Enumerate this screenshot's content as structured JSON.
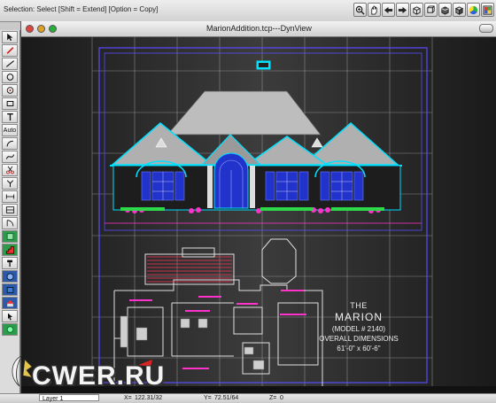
{
  "status_bar": {
    "text": "Selection: Select  [Shift = Extend]  [Option = Copy]"
  },
  "toolbar_icons": [
    "zoom-in-icon",
    "hand-pan-icon",
    "undo-arrow-icon",
    "redo-arrow-icon",
    "box-3d-icon",
    "box-3d-wire-icon",
    "box-3d-solid-icon",
    "color-wheel-icon",
    "palette-icon"
  ],
  "window": {
    "title": "MarionAddition.tcp---DynView"
  },
  "palette": {
    "auto_label": "Auto",
    "icons": [
      "arrow-select-icon",
      "pencil-icon",
      "line-icon",
      "circle-icon",
      "circle-dot-icon",
      "rectangle-icon",
      "text-icon",
      "auto-icon",
      "arc-icon",
      "curve-icon",
      "scissors-icon",
      "join-icon",
      "dimension-icon",
      "wall-icon",
      "door-icon",
      "window-icon",
      "stairs-icon",
      "hammer-icon",
      "cube-icon",
      "cube-blue-icon",
      "roof-icon",
      "pointer-icon",
      "green-shape-icon"
    ]
  },
  "drawing": {
    "label_line1": "THE",
    "label_line2": "MARION",
    "label_line3": "(MODEL # 2140)",
    "label_line4": "OVERALL DIMENSIONS",
    "label_line5": "61'-0\" x 60'-6\""
  },
  "bottom_bar": {
    "layer": "Layer 1",
    "x_label": "X=",
    "x_value": "122.31/32",
    "y_label": "Y=",
    "y_value": "72.51/64",
    "z_label": "Z=",
    "z_value": "0"
  },
  "watermark": {
    "text": "CWER.RU"
  },
  "colors": {
    "outline": "#6a5cff",
    "trim": "#00e0ff",
    "roof": "#bdbdbd",
    "window": "#2233cc",
    "plants": "#ff33cc",
    "grid": "#9a9a9a"
  }
}
